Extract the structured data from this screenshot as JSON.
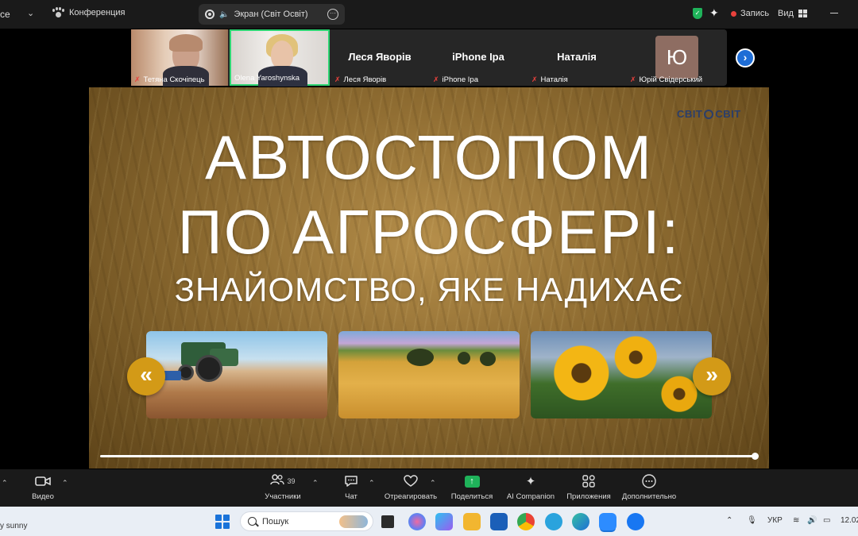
{
  "topbar": {
    "app_title_fragment": "ce",
    "conference_label": "Конференция",
    "share_label": "Экран (Світ Освіт)",
    "record_label": "Запись",
    "view_label": "Вид"
  },
  "participants": [
    {
      "name": "Тетяна Скочіпець",
      "muted": true,
      "has_video": true
    },
    {
      "name": "Olena Yaroshynska",
      "muted": false,
      "has_video": true,
      "speaking": true
    },
    {
      "name": "Леся Яворів",
      "display": "Леся Яворів",
      "muted": true,
      "has_video": false
    },
    {
      "name": "iPhone Ipa",
      "display": "iPhone Ipa",
      "muted": true,
      "has_video": false
    },
    {
      "name": "Наталія",
      "display": "Наталія",
      "muted": true,
      "has_video": false
    },
    {
      "name": "Юрій Свідерський",
      "avatar_letter": "Ю",
      "muted": true,
      "has_video": false
    }
  ],
  "slide": {
    "logo_left": "СВІТ",
    "logo_right": "СВІТ",
    "title_line1": "АВТОСТОПОМ",
    "title_line2": "ПО АГРОСФЕРІ:",
    "subtitle": "ЗНАЙОМСТВО, ЯКЕ НАДИХАЄ",
    "prev_arrow": "«",
    "next_arrow": "»",
    "progress_fraction": 1.0
  },
  "toolbar": {
    "video": "Видео",
    "participants": "Участники",
    "participants_count": "39",
    "chat": "Чат",
    "react": "Отреагировать",
    "share": "Поделиться",
    "ai": "AI Companion",
    "apps": "Приложения",
    "more": "Дополнительно"
  },
  "taskbar": {
    "weather": "y sunny",
    "search_label": "Пошук",
    "language": "УКР",
    "date_fragment": "12.02"
  },
  "colors": {
    "accent_green": "#2ed573",
    "mute_red": "#e8413c",
    "slide_arrow": "#d39a17",
    "next_button": "#1e6dd6"
  }
}
